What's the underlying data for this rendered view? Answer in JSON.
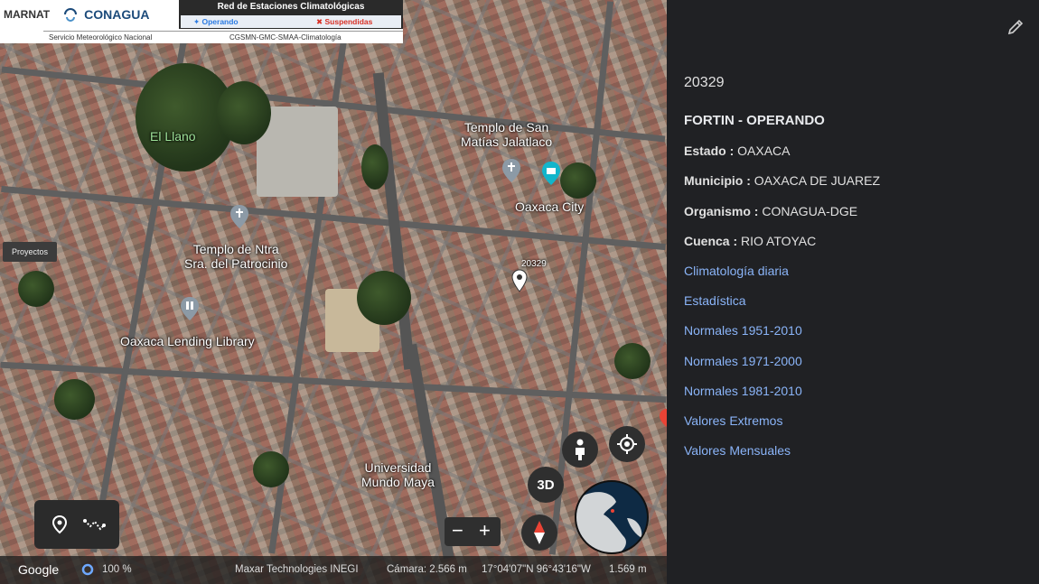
{
  "banner": {
    "agency_left": "MARNAT",
    "agency_right": "CONAGUA",
    "network_title": "Red de Estaciones Climatológicas",
    "legend_operating": "Operando",
    "legend_suspended": "Suspendidas",
    "service": "Servicio Meteorológico Nacional",
    "department": "CGSMN-GMC-SMAA-Climatología"
  },
  "map": {
    "projects_label": "Proyectos",
    "labels": {
      "el_llano": "El Llano",
      "templo_san_matias": "Templo de San\nMatías Jalatlaco",
      "oaxaca_city": "Oaxaca City",
      "templo_patrocinio": "Templo de Ntra\nSra. del Patrocinio",
      "lending_library": "Oaxaca Lending Library",
      "universidad": "Universidad\nMundo Maya",
      "station_marker": "20329"
    },
    "button_3d": "3D",
    "zoom_minus": "−",
    "zoom_plus": "+"
  },
  "statusbar": {
    "google": "Google",
    "load": "100 %",
    "attribution": "Maxar Technologies   INEGI",
    "camera": "Cámara: 2.566 m",
    "coords": "17°04'07\"N 96°43'16\"W",
    "elevation": "1.569 m"
  },
  "panel": {
    "station_id": "20329",
    "station_name": "FORTIN - OPERANDO",
    "estado_label": "Estado : ",
    "estado_value": "OAXACA",
    "municipio_label": "Municipio : ",
    "municipio_value": "OAXACA DE JUAREZ",
    "organismo_label": "Organismo : ",
    "organismo_value": "CONAGUA-DGE",
    "cuenca_label": "Cuenca : ",
    "cuenca_value": "RIO ATOYAC",
    "links": [
      "Climatología diaria",
      "Estadística",
      "Normales 1951-2010",
      "Normales 1971-2000",
      "Normales 1981-2010",
      "Valores Extremos",
      "Valores Mensuales"
    ]
  },
  "colors": {
    "panel_bg": "#202124",
    "link": "#8ab4f8",
    "operating": "#2a7ae2",
    "suspended": "#d93025"
  }
}
